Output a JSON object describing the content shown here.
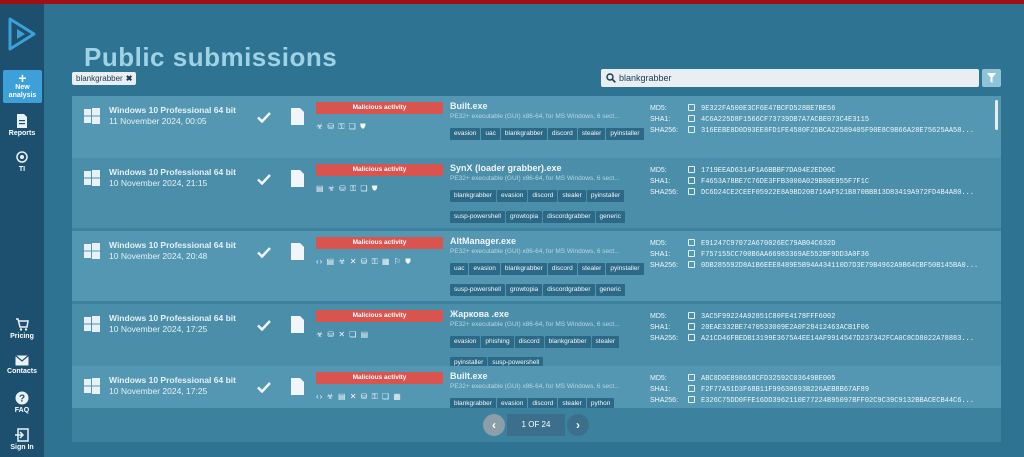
{
  "sidebar": {
    "new_analysis": "New analysis",
    "items": [
      {
        "label": "Reports",
        "icon": "reports-icon"
      },
      {
        "label": "TI",
        "icon": "ti-icon"
      },
      {
        "label": "Pricing",
        "icon": "cart-icon"
      },
      {
        "label": "Contacts",
        "icon": "mail-icon"
      },
      {
        "label": "FAQ",
        "icon": "question-icon"
      },
      {
        "label": "Sign In",
        "icon": "sign-in-icon"
      }
    ]
  },
  "page": {
    "title": "Public submissions",
    "filter_tag": "blankgrabber",
    "search_value": "blankgrabber"
  },
  "submissions": [
    {
      "os": "Windows 10 Professional 64 bit",
      "date": "11 November 2024, 00:05",
      "verdict": "Malicious activity",
      "icons": "☣ ⛁ ⚿ ❏ ⛊",
      "file": "Built.exe",
      "desc": "PE32+ executable (GUI) x86-64, for MS Windows, 6 sect...",
      "tags": [
        "evasion",
        "uac",
        "blankgrabber",
        "discord",
        "stealer",
        "pyinstaller"
      ],
      "md5": "9E322FA500E3CF6E47BCFD528BE7BE56",
      "sha1": "4C6A225D8F1566CF73739DB7A7ACBE073C4E3115",
      "sha256": "316EEBE8D0D93EE8FD1FE4580F25BCA22589405F90E8C9B66A28E75625AA58..."
    },
    {
      "os": "Windows 10 Professional 64 bit",
      "date": "10 November 2024, 21:15",
      "verdict": "Malicious activity",
      "icons": "▤ ☣ ⛁ ⚿ ❏ ⛊",
      "file": "SynX (loader grabber).exe",
      "desc": "PE32+ executable (GUI) x86-64, for MS Windows, 6 sect...",
      "tags": [
        "blankgrabber",
        "evasion",
        "discord",
        "stealer",
        "pyinstaller",
        "susp-powershell",
        "growtopia",
        "discordgrabber",
        "generic",
        "umbralstealer",
        "ims-api"
      ],
      "md5": "1719EEAD6314F1A6BBBF7DA94E2ED00C",
      "sha1": "F4653A78BE7C76DE3FFB3000A029B80E955F7F1C",
      "sha256": "DC6D24CE2CEEF05922E8A9BD20B716AF521B870BBB13D83419A972FD4B4A80..."
    },
    {
      "os": "Windows 10 Professional 64 bit",
      "date": "10 November 2024, 20:48",
      "verdict": "Malicious activity",
      "icons": "‹› ▤ ☣ ✕ ⛁ ⚿ ▦ ⚐ ⛊",
      "file": "AltManager.exe",
      "desc": "PE32+ executable (GUI) x86-64, for MS Windows, 6 sect...",
      "tags": [
        "uac",
        "evasion",
        "blankgrabber",
        "discord",
        "stealer",
        "pyinstaller",
        "susp-powershell",
        "growtopia",
        "discordgrabber",
        "generic",
        "ims-api",
        "upx",
        "python"
      ],
      "md5": "E91247C97072A670026EC79AB04C632D",
      "sha1": "F757155CC700B6AA66983369AE552BF9DD3A0F36",
      "sha256": "0DB285592D8A1B6EEE8489E5B94A434110D7D3E79B4962A9B64CBF50B145BA0..."
    },
    {
      "os": "Windows 10 Professional 64 bit",
      "date": "10 November 2024, 17:25",
      "verdict": "Malicious activity",
      "icons": "☣ ⛁ ✕ ❏ ▤",
      "file": "Жаркова .exe",
      "desc": "PE32+ executable (GUI) x86-64, for MS Windows, 6 sect...",
      "tags": [
        "evasion",
        "phishing",
        "discord",
        "blankgrabber",
        "stealer",
        "pyinstaller",
        "susp-powershell"
      ],
      "md5": "3AC5F99224A92851C80FE4178FFF6002",
      "sha1": "20EAE332BE7470533009E2A0F28412463ACB1F06",
      "sha256": "A21CD46FBEDB13199E3675A4EE14AF9914547D237342FCA0C8CD8022A78883..."
    },
    {
      "os": "Windows 10 Professional 64 bit",
      "date": "10 November 2024, 17:25",
      "verdict": "Malicious activity",
      "icons": "‹› ☣ ▤ ✕ ⛁ ⚿ ❏ ▦",
      "file": "Built.exe",
      "desc": "PE32+ executable (GUI) x86-64, for MS Windows, 6 sect...",
      "tags": [
        "blankgrabber",
        "evasion",
        "discord",
        "stealer",
        "python"
      ],
      "md5": "ABC8D0E898658CFD32592C03649BE005",
      "sha1": "F2F77A51D3F68B11F99630693B226AEB8B67AF89",
      "sha256": "E326C75DD0FFE16DD3962110E77224B95097BFF02C9C39C9132BBACECB44C6..."
    }
  ],
  "hash_labels": {
    "md5": "MD5:",
    "sha1": "SHA1:",
    "sha256": "SHA256:"
  },
  "pager": {
    "prev": "‹",
    "label": "1 OF 24",
    "next": "›"
  }
}
